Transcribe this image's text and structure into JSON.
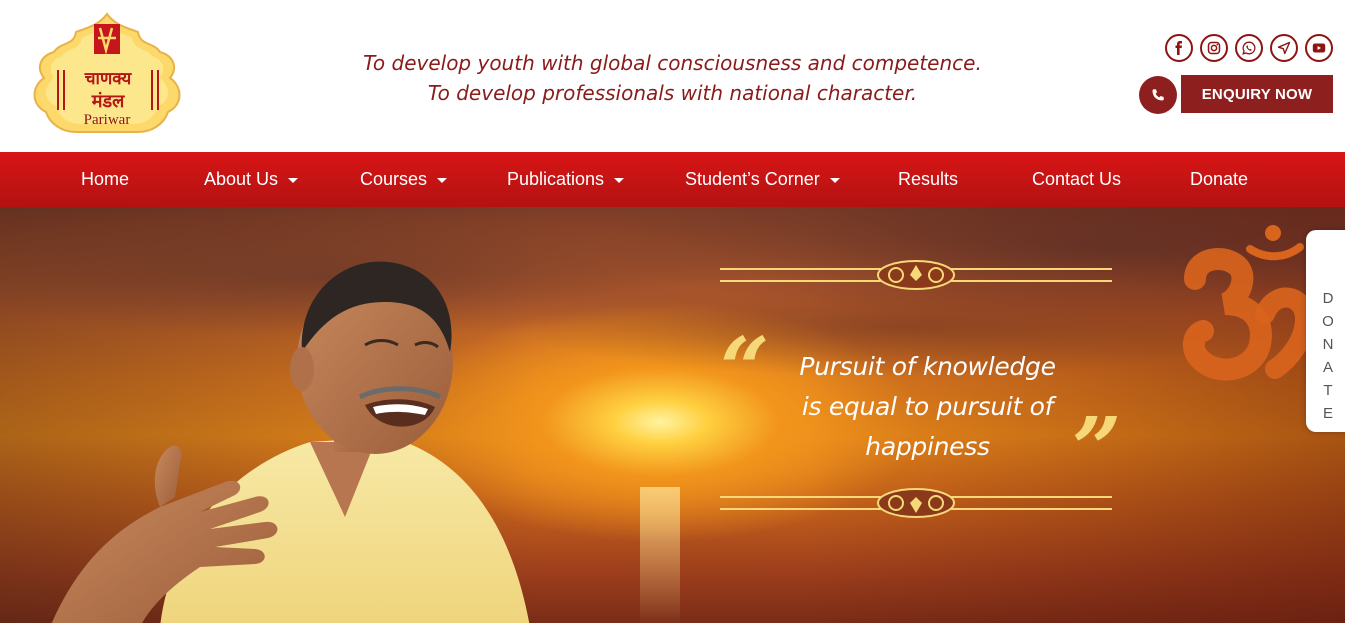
{
  "header": {
    "logo": {
      "alt": "Chanakya Mandal Pariwar logo",
      "text_sub": "Pariwar"
    },
    "tagline_line1": "To develop youth with global consciousness and competence.",
    "tagline_line2": "To develop professionals with national character.",
    "socials": [
      {
        "icon": "facebook-icon"
      },
      {
        "icon": "instagram-icon"
      },
      {
        "icon": "whatsapp-icon"
      },
      {
        "icon": "location-arrow-icon"
      },
      {
        "icon": "youtube-icon"
      }
    ],
    "phone_icon": "phone-icon",
    "enquiry_label": "ENQUIRY NOW"
  },
  "nav": {
    "items": [
      {
        "label": "Home",
        "has_dropdown": false
      },
      {
        "label": "About Us",
        "has_dropdown": true
      },
      {
        "label": "Courses",
        "has_dropdown": true
      },
      {
        "label": "Publications",
        "has_dropdown": true
      },
      {
        "label": "Student’s Corner",
        "has_dropdown": true
      },
      {
        "label": "Results",
        "has_dropdown": false
      },
      {
        "label": "Contact Us",
        "has_dropdown": false
      },
      {
        "label": "Donate",
        "has_dropdown": false
      }
    ]
  },
  "hero": {
    "quote_open": "“",
    "quote_close": "”",
    "quote_line1": "Pursuit of knowledge",
    "quote_line2": "is equal to pursuit of",
    "quote_line3": "happiness"
  },
  "donate_tab": {
    "letters": [
      "D",
      "O",
      "N",
      "A",
      "T",
      "E"
    ]
  },
  "colors": {
    "brand_maroon": "#8e1f1f",
    "nav_red": "#d81515",
    "gold": "#f7d878"
  }
}
